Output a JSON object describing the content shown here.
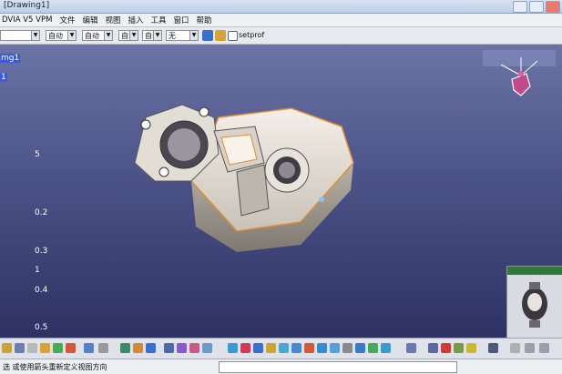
{
  "window": {
    "title": "[Drawing1]"
  },
  "menu": [
    "DVIA V5 VPM",
    "文件",
    "编辑",
    "视图",
    "插入",
    "工具",
    "窗口",
    "帮助"
  ],
  "toolbar": {
    "combos": [
      "",
      "自动",
      "自动",
      "自动",
      "自动",
      "无"
    ],
    "setprof_label": "setprof"
  },
  "tree": {
    "items": [
      "mg1",
      "1",
      "5",
      "0.2",
      "0.3",
      "1",
      "0.4",
      "0.5"
    ]
  },
  "status": {
    "text": "选 或使用箭头重新定义视图方向"
  },
  "colors": {
    "viewport_top": "#6c73a5",
    "viewport_bottom": "#2d3262",
    "selection": "#3b5bd8",
    "part_edge": "#e08b3a"
  }
}
